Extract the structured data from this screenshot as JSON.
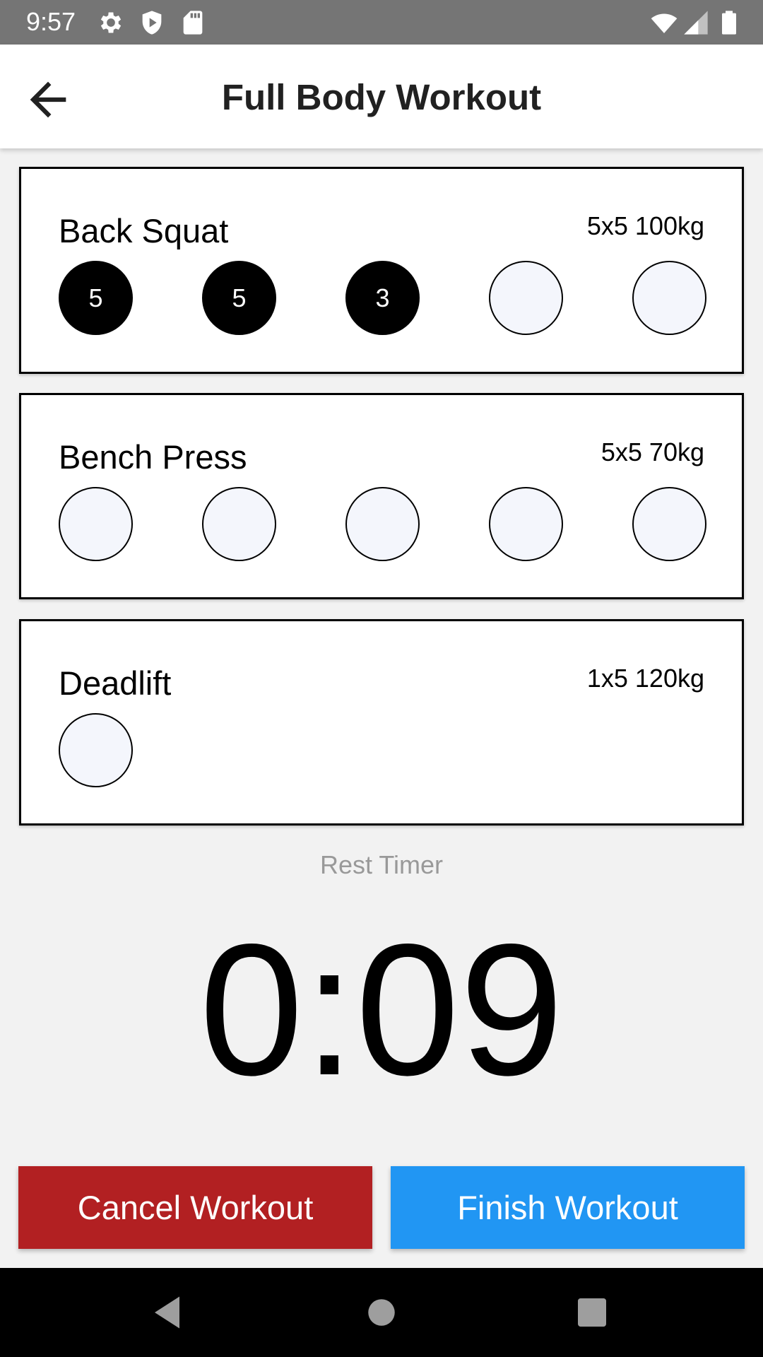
{
  "status_bar": {
    "time": "9:57",
    "icons": [
      "settings-icon",
      "shield-icon",
      "sd-card-icon",
      "wifi-icon",
      "signal-icon",
      "battery-icon"
    ]
  },
  "app_bar": {
    "title": "Full Body Workout",
    "back_icon": "arrow-back-icon"
  },
  "exercises": [
    {
      "name": "Back Squat",
      "scheme": "5x5 100kg",
      "sets": [
        {
          "reps": "5",
          "completed": true
        },
        {
          "reps": "5",
          "completed": true
        },
        {
          "reps": "3",
          "completed": true
        },
        {
          "reps": "",
          "completed": false
        },
        {
          "reps": "",
          "completed": false
        }
      ]
    },
    {
      "name": "Bench Press",
      "scheme": "5x5 70kg",
      "sets": [
        {
          "reps": "",
          "completed": false
        },
        {
          "reps": "",
          "completed": false
        },
        {
          "reps": "",
          "completed": false
        },
        {
          "reps": "",
          "completed": false
        },
        {
          "reps": "",
          "completed": false
        }
      ]
    },
    {
      "name": "Deadlift",
      "scheme": "1x5 120kg",
      "sets": [
        {
          "reps": "",
          "completed": false
        }
      ]
    }
  ],
  "rest_timer": {
    "label": "Rest Timer",
    "value": "0:09"
  },
  "actions": {
    "cancel_label": "Cancel Workout",
    "finish_label": "Finish Workout"
  },
  "colors": {
    "cancel": "#b22022",
    "finish": "#2196f3",
    "set_done": "#000000",
    "set_empty": "#f4f6fc"
  },
  "nav_bar": {
    "icons": [
      "back-triangle-icon",
      "home-circle-icon",
      "recents-square-icon"
    ]
  }
}
